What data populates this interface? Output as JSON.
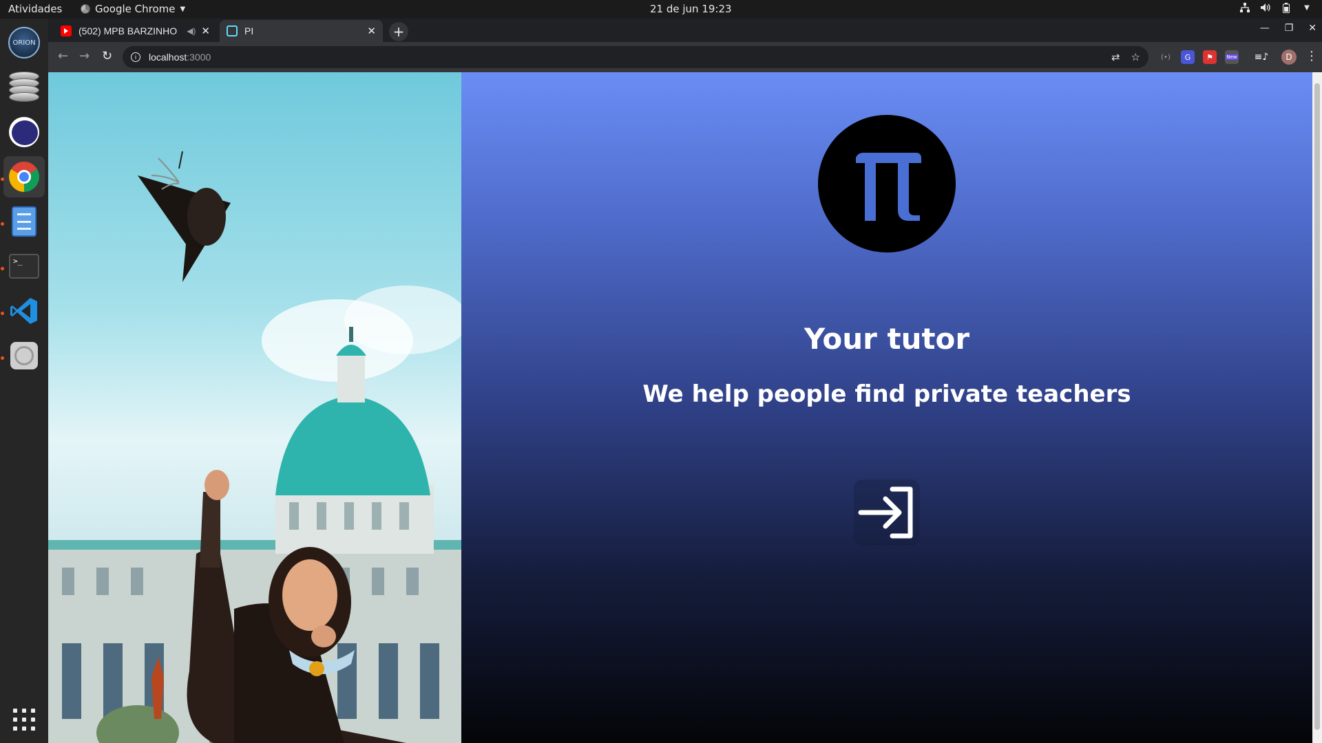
{
  "topbar": {
    "activities": "Atividades",
    "app_name": "Google Chrome",
    "clock": "21 de jun  19:23"
  },
  "dock": {
    "apps": [
      "orion-icon",
      "database-icon",
      "eclipse-icon",
      "chrome-icon",
      "files-icon",
      "terminal-icon",
      "vscode-icon",
      "disc-icon"
    ],
    "logo_text": "ORION"
  },
  "browser": {
    "tabs": [
      {
        "title": "(502) MPB BARZINHO",
        "active": false
      },
      {
        "title": "PI",
        "active": true
      }
    ],
    "url_host": "localhost",
    "url_port": ":3000",
    "ext_new_badge": "New",
    "profile_initial": "D"
  },
  "page": {
    "title": "Your tutor",
    "subtitle": "We help people find private teachers",
    "logo_symbol": "π",
    "colors": {
      "gradient_top": "#6a8df5",
      "gradient_bottom": "#040508",
      "logo_bg": "#000000",
      "logo_glyph": "#4a6fd4"
    }
  }
}
